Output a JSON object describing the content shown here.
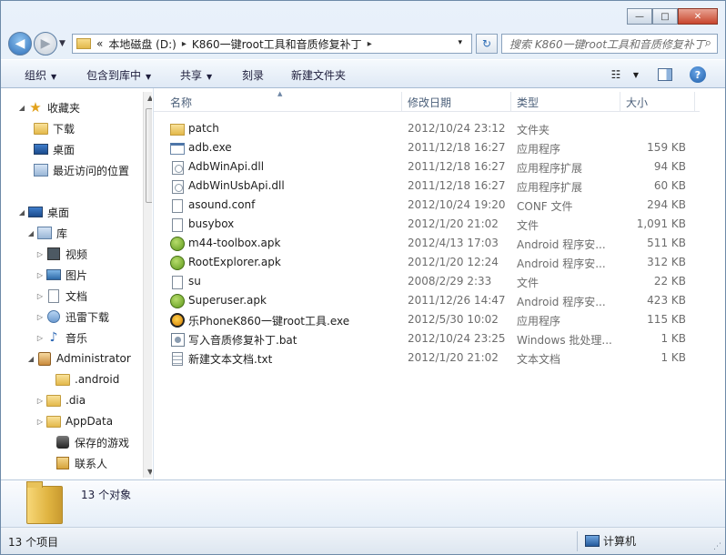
{
  "window": {
    "buttons": {
      "minimize": "—",
      "maximize": "□",
      "close": "✕"
    }
  },
  "address": {
    "chevron": "«",
    "crumbs": [
      "本地磁盘 (D:)",
      "K860一键root工具和音质修复补丁"
    ],
    "separator": "▸",
    "dropdown": "▾",
    "search_placeholder": "搜索 K860一键root工具和音质修复补丁"
  },
  "toolbar": {
    "organize": "组织",
    "include_in_library": "包含到库中",
    "share": "共享",
    "burn": "刻录",
    "new_folder": "新建文件夹",
    "help": "?"
  },
  "nav": {
    "favorites": "收藏夹",
    "downloads": "下载",
    "desktop_fav": "桌面",
    "recent": "最近访问的位置",
    "desktop": "桌面",
    "libraries": "库",
    "videos": "视频",
    "pictures": "图片",
    "documents": "文档",
    "thunder": "迅雷下载",
    "music": "音乐",
    "administrator": "Administrator",
    "android": ".android",
    "dia": ".dia",
    "appdata": "AppData",
    "saved_games": "保存的游戏",
    "contacts": "联系人"
  },
  "columns": {
    "name": "名称",
    "date": "修改日期",
    "type": "类型",
    "size": "大小"
  },
  "files": [
    {
      "name": "patch",
      "date": "2012/10/24 23:12",
      "type": "文件夹",
      "size": "",
      "icon": "folder-icon"
    },
    {
      "name": "adb.exe",
      "date": "2011/12/18 16:27",
      "type": "应用程序",
      "size": "159 KB",
      "icon": "exe-icon"
    },
    {
      "name": "AdbWinApi.dll",
      "date": "2011/12/18 16:27",
      "type": "应用程序扩展",
      "size": "94 KB",
      "icon": "dll-icon"
    },
    {
      "name": "AdbWinUsbApi.dll",
      "date": "2011/12/18 16:27",
      "type": "应用程序扩展",
      "size": "60 KB",
      "icon": "dll-icon"
    },
    {
      "name": "asound.conf",
      "date": "2012/10/24 19:20",
      "type": "CONF 文件",
      "size": "294 KB",
      "icon": "file-icon"
    },
    {
      "name": "busybox",
      "date": "2012/1/20 21:02",
      "type": "文件",
      "size": "1,091 KB",
      "icon": "file-icon"
    },
    {
      "name": "m44-toolbox.apk",
      "date": "2012/4/13 17:03",
      "type": "Android 程序安...",
      "size": "511 KB",
      "icon": "apk-icon"
    },
    {
      "name": "RootExplorer.apk",
      "date": "2012/1/20 12:24",
      "type": "Android 程序安...",
      "size": "312 KB",
      "icon": "apk-icon"
    },
    {
      "name": "su",
      "date": "2008/2/29 2:33",
      "type": "文件",
      "size": "22 KB",
      "icon": "file-icon"
    },
    {
      "name": "Superuser.apk",
      "date": "2011/12/26 14:47",
      "type": "Android 程序安...",
      "size": "423 KB",
      "icon": "apk-icon"
    },
    {
      "name": "乐PhoneK860一键root工具.exe",
      "date": "2012/5/30 10:02",
      "type": "应用程序",
      "size": "115 KB",
      "icon": "app-icon"
    },
    {
      "name": "写入音质修复补丁.bat",
      "date": "2012/10/24 23:25",
      "type": "Windows 批处理...",
      "size": "1 KB",
      "icon": "bat-icon"
    },
    {
      "name": "新建文本文档.txt",
      "date": "2012/1/20 21:02",
      "type": "文本文档",
      "size": "1 KB",
      "icon": "txt-icon"
    }
  ],
  "details": {
    "count": "13 个对象"
  },
  "status": {
    "items": "13 个项目",
    "location": "计算机"
  }
}
